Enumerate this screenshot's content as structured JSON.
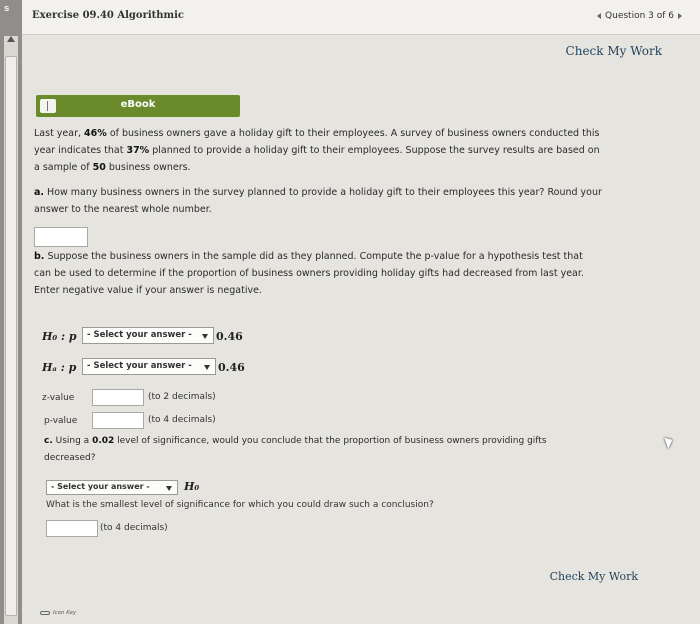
{
  "edge_letter": "s",
  "header": {
    "exercise_title": "Exercise 09.40 Algorithmic",
    "question_nav": "Question 3 of 6"
  },
  "check_my_work_top": "Check My Work",
  "ebook_label": "eBook",
  "problem": {
    "line1_a": "Last year, ",
    "pct_last_year": "46%",
    "line1_b": " of business owners gave a holiday gift to their employees. A survey of business owners conducted this",
    "line2_a": "year indicates that ",
    "pct_this_year": "37%",
    "line2_b": " planned to provide a holiday gift to their employees. Suppose the survey results are based on",
    "line3_a": "a sample of ",
    "sample_size": "50",
    "line3_b": " business owners."
  },
  "part_a": {
    "letter": "a.",
    "line1": " How many business owners in the survey planned to provide a holiday gift to their employees this year? Round your",
    "line2": "answer to the nearest whole number."
  },
  "part_b": {
    "letter": "b.",
    "line1": " Suppose the business owners in the sample did as they planned. Compute the p-value for a hypothesis test that",
    "line2": "can be used to determine if the proportion of business owners providing holiday gifts had decreased from last year.",
    "line3": "Enter negative value if your answer is negative."
  },
  "h0": {
    "symbol": "H₀ : p",
    "select": "- Select your answer -",
    "value": "0.46"
  },
  "ha": {
    "symbol": "Hₐ : p",
    "select": "- Select your answer -",
    "value": "0.46"
  },
  "z_value": {
    "label": "z-value",
    "hint": "(to 2 decimals)"
  },
  "p_value": {
    "label": "p-value",
    "hint": "(to 4 decimals)"
  },
  "part_c": {
    "letter": "c.",
    "line1_a": " Using a ",
    "alpha": "0.02",
    "line1_b": " level of significance, would you conclude that the proportion of business owners providing gifts",
    "line2": "decreased?",
    "select": "- Select your answer -",
    "h0_symbol": "H₀",
    "question": "What is the smallest level of significance for which you could draw such a conclusion?",
    "hint": "(to 4 decimals)"
  },
  "check_my_work_bottom": "Check My Work",
  "icon_key": "Icon Key"
}
